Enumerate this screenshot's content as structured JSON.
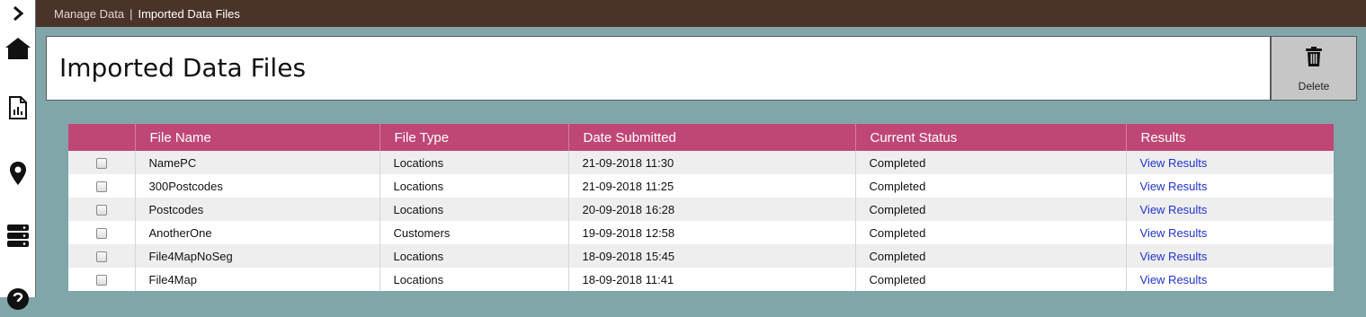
{
  "breadcrumb": {
    "parent": "Manage Data",
    "separator": "|",
    "current": "Imported Data Files"
  },
  "page": {
    "title": "Imported Data Files"
  },
  "toolbar": {
    "delete_label": "Delete"
  },
  "sidebar": {
    "toggle_icon": "chevron-right-icon",
    "items": [
      {
        "icon": "home-icon"
      },
      {
        "icon": "report-icon"
      },
      {
        "icon": "map-pin-icon"
      },
      {
        "icon": "database-icon"
      },
      {
        "icon": "help-icon"
      }
    ]
  },
  "table": {
    "headers": [
      "File Name",
      "File Type",
      "Date Submitted",
      "Current Status",
      "Results"
    ],
    "rows": [
      {
        "file_name": "NamePC",
        "file_type": "Locations",
        "date": "21-09-2018 11:30",
        "status": "Completed",
        "results": "View Results"
      },
      {
        "file_name": "300Postcodes",
        "file_type": "Locations",
        "date": "21-09-2018 11:25",
        "status": "Completed",
        "results": "View Results"
      },
      {
        "file_name": "Postcodes",
        "file_type": "Locations",
        "date": "20-09-2018 16:28",
        "status": "Completed",
        "results": "View Results"
      },
      {
        "file_name": "AnotherOne",
        "file_type": "Customers",
        "date": "19-09-2018 12:58",
        "status": "Completed",
        "results": "View Results"
      },
      {
        "file_name": "File4MapNoSeg",
        "file_type": "Locations",
        "date": "18-09-2018 15:45",
        "status": "Completed",
        "results": "View Results"
      },
      {
        "file_name": "File4Map",
        "file_type": "Locations",
        "date": "18-09-2018 11:41",
        "status": "Completed",
        "results": "View Results"
      }
    ]
  },
  "colors": {
    "topbar": "#4a3328",
    "header": "#bf4775",
    "background": "#80a6a9",
    "link": "#2233cc"
  }
}
